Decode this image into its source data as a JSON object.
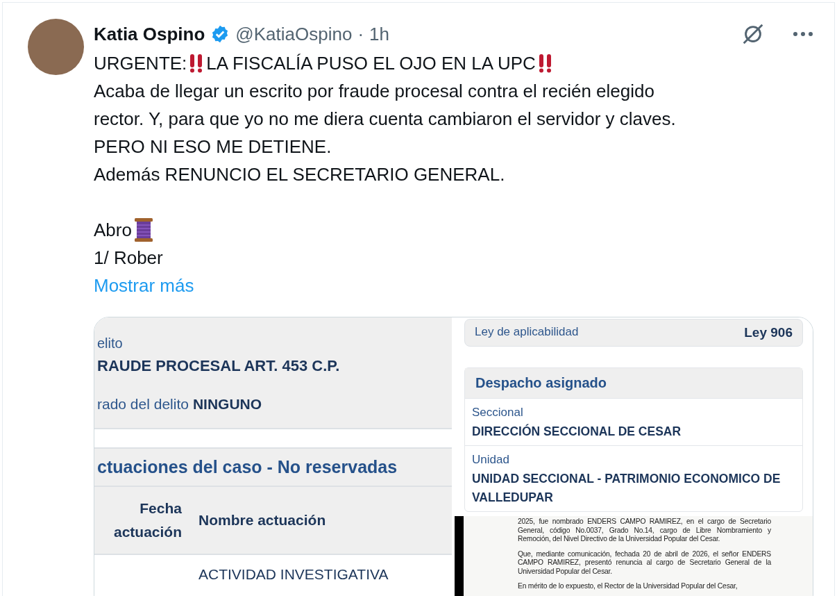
{
  "tweet": {
    "author": {
      "name": "Katia Ospino",
      "verified": true,
      "handle": "@KatiaOspino",
      "separator": "·",
      "time": "1h"
    },
    "paragraphs": [
      {
        "lines": [
          {
            "parts": [
              {
                "kind": "text",
                "text": "URGENTE: "
              },
              {
                "kind": "double-exclamation"
              },
              {
                "kind": "text",
                "text": "LA FISCALÍA PUSO EL OJO EN LA UPC"
              },
              {
                "kind": "double-exclamation"
              }
            ]
          },
          {
            "parts": [
              {
                "kind": "text",
                "text": "Acaba de llegar un escrito por fraude procesal contra el recién elegido"
              }
            ]
          },
          {
            "parts": [
              {
                "kind": "text",
                "text": "rector. Y, para que yo no me diera cuenta cambiaron el servidor y claves."
              }
            ]
          },
          {
            "parts": [
              {
                "kind": "text",
                "text": "PERO NI ESO ME DETIENE."
              }
            ]
          },
          {
            "parts": [
              {
                "kind": "text",
                "text": "Además RENUNCIO EL SECRETARIO GENERAL."
              }
            ]
          }
        ]
      },
      {
        "lines": [
          {
            "parts": [
              {
                "kind": "text",
                "text": "Abro "
              },
              {
                "kind": "spool"
              }
            ]
          },
          {
            "parts": [
              {
                "kind": "text",
                "text": "1/ Rober"
              }
            ]
          }
        ]
      }
    ],
    "show_more": "Mostrar más"
  },
  "media": {
    "left_panel": {
      "delito_label": "elito",
      "delito_value": "RAUDE PROCESAL ART. 453 C.P.",
      "grado_label": "rado del delito",
      "grado_value": "NINGUNO",
      "section_title": "ctuaciones del caso - No reservadas",
      "columns": [
        {
          "lines": [
            "Fecha",
            "actuación"
          ]
        },
        {
          "lines": [
            "Nombre actuación"
          ]
        }
      ],
      "rows": [
        {
          "cells": [
            "",
            "ACTIVIDAD INVESTIGATIVA"
          ]
        }
      ]
    },
    "right_panel": {
      "ley_label": "Ley de aplicabilidad",
      "ley_value": "Ley 906",
      "card_title": "Despacho asignado",
      "fields": [
        {
          "label": "Seccional",
          "value": "DIRECCIÓN SECCIONAL DE CESAR"
        },
        {
          "label": "Unidad",
          "value": "UNIDAD SECCIONAL - PATRIMONIO ECONOMICO DE VALLEDUPAR"
        }
      ]
    },
    "document": {
      "paragraphs": [
        "2025, fue nombrado ENDERS CAMPO RAMIREZ, en el cargo de Secretario General, código No.0037, Grado No.14, cargo de Libre Nombramiento y Remoción, del Nivel Directivo de la Universidad Popular del Cesar.",
        "Que, mediante comunicación, fechada 20 de abril de 2026, el señor ENDERS CAMPO RAMIREZ, presentó renuncia al cargo de Secretario General de la Universidad Popular del Cesar.",
        "En mérito de lo expuesto, el Rector de la Universidad Popular del Cesar,"
      ]
    }
  }
}
